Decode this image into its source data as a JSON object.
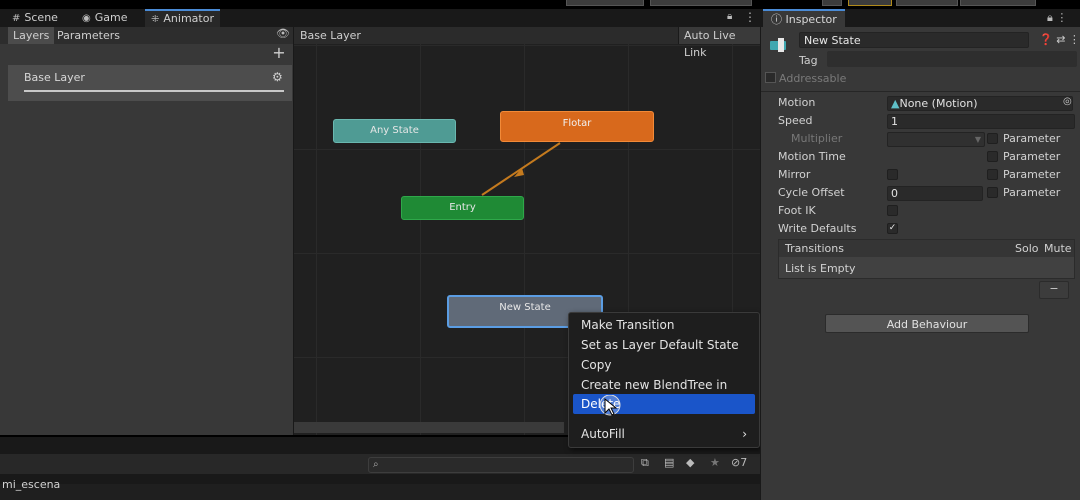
{
  "top_tabs": [
    {
      "label": "Scene",
      "icon": "grid-icon"
    },
    {
      "label": "Game",
      "icon": "gamepad-icon"
    },
    {
      "label": "Animator",
      "icon": "animator-icon"
    }
  ],
  "left_panel": {
    "tabs": [
      "Layers",
      "Parameters"
    ],
    "layer_name": "Base Layer"
  },
  "graph": {
    "breadcrumb": "Base Layer",
    "auto_live_link": "Auto Live Link",
    "nodes": {
      "any_state": "Any State",
      "flotar": "Flotar",
      "entry": "Entry",
      "new_state": "New State"
    },
    "colors": {
      "any_state": "#4f9b94",
      "flotar": "#d8691c",
      "entry": "#1f8a35",
      "new_state": "#606a78",
      "selection": "#5b9de3",
      "transition_arrow": "#c47a1e"
    }
  },
  "context_menu": {
    "items": [
      "Make Transition",
      "Set as Layer Default State",
      "Copy",
      "Create new BlendTree in State",
      "Delete",
      "AutoFill"
    ],
    "highlighted": "Delete"
  },
  "bottom": {
    "scene_name": "mi_escena",
    "hidden_count": "7"
  },
  "inspector": {
    "tab": "Inspector",
    "name": "New State",
    "tag_label": "Tag",
    "addressable": "Addressable",
    "props": {
      "motion_label": "Motion",
      "motion_value": "None (Motion)",
      "speed_label": "Speed",
      "speed_value": "1",
      "multiplier_label": "Multiplier",
      "motion_time_label": "Motion Time",
      "mirror_label": "Mirror",
      "cycle_offset_label": "Cycle Offset",
      "cycle_offset_value": "0",
      "foot_ik_label": "Foot IK",
      "write_defaults_label": "Write Defaults",
      "parameter_label": "Parameter"
    },
    "transitions": {
      "title": "Transitions",
      "solo": "Solo",
      "mute": "Mute",
      "empty": "List is Empty"
    },
    "add_behaviour": "Add Behaviour",
    "minus": "−"
  }
}
